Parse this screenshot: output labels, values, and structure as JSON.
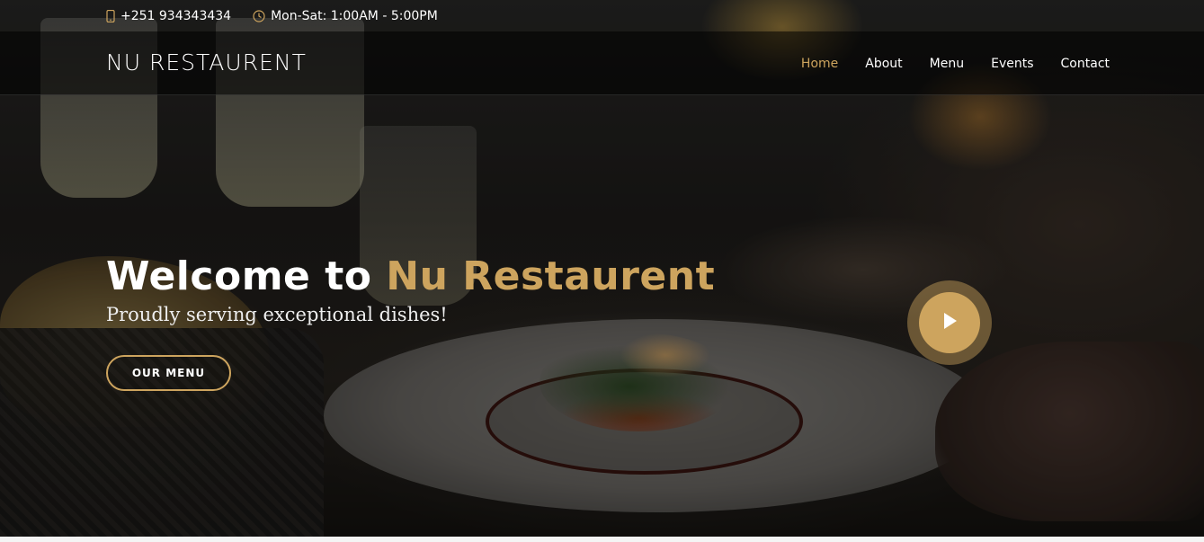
{
  "topbar": {
    "phone": "+251 934343434",
    "phone_icon": "mobile-phone-icon",
    "hours": "Mon-Sat: 1:00AM - 5:00PM",
    "hours_icon": "clock-icon"
  },
  "header": {
    "logo": "NU RESTAURENT",
    "nav": [
      {
        "label": "Home",
        "active": true
      },
      {
        "label": "About",
        "active": false
      },
      {
        "label": "Menu",
        "active": false
      },
      {
        "label": "Events",
        "active": false
      },
      {
        "label": "Contact",
        "active": false
      }
    ]
  },
  "hero": {
    "title_prefix": "Welcome to",
    "title_accent": "Nu Restaurent",
    "subtitle": "Proudly serving exceptional dishes!",
    "cta_label": "OUR MENU",
    "play_icon": "play-icon"
  },
  "colors": {
    "accent": "#cda45e",
    "text": "#ffffff",
    "header_bg": "rgba(0,0,0,0.55)"
  }
}
